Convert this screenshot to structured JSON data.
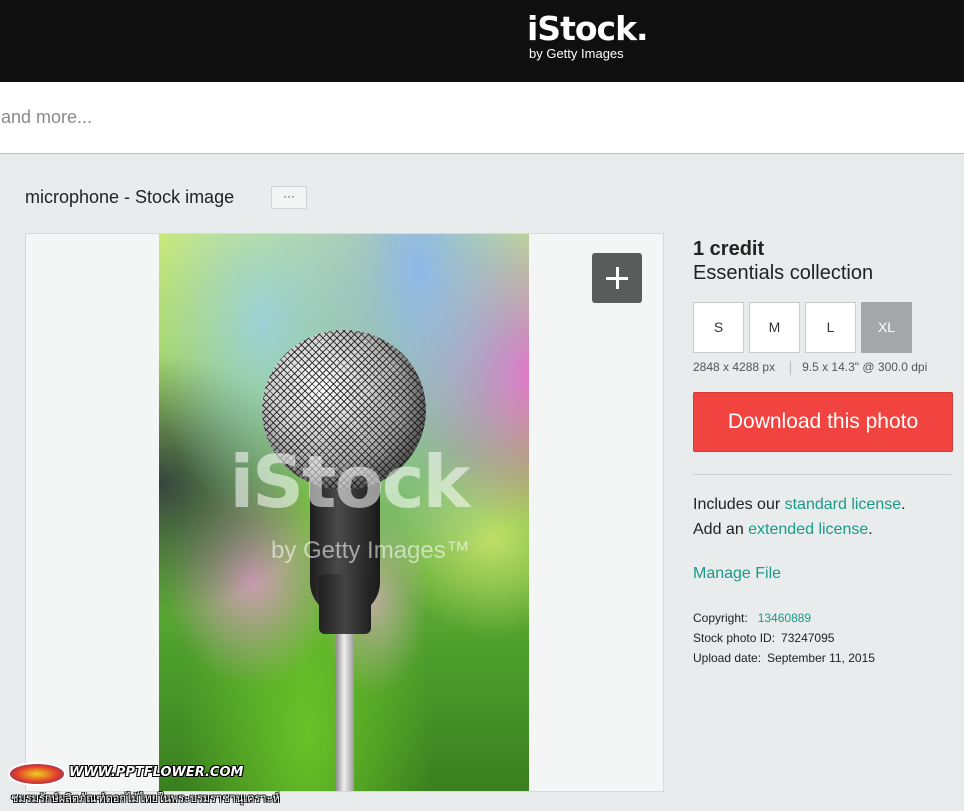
{
  "header": {
    "logo_main": "iStock.",
    "logo_sub": "by Getty Images"
  },
  "search": {
    "placeholder": "vectors and more..."
  },
  "page": {
    "title": "microphone - Stock image",
    "more_label": "···"
  },
  "preview": {
    "watermark_main": "iStock",
    "watermark_sub": "by Getty Images™"
  },
  "purchase": {
    "credit": "1 credit",
    "collection": "Essentials collection",
    "sizes": [
      {
        "label": "S",
        "selected": false
      },
      {
        "label": "M",
        "selected": false
      },
      {
        "label": "L",
        "selected": false
      },
      {
        "label": "XL",
        "selected": true
      }
    ],
    "pixel_dimensions": "2848 x 4288 px",
    "print_dimensions": "9.5 x 14.3\" @ 300.0 dpi",
    "download_label": "Download this photo"
  },
  "license": {
    "line1_prefix": "Includes our ",
    "line1_link": "standard license",
    "line1_suffix": ".",
    "line2_prefix": "Add an ",
    "line2_link": "extended license",
    "line2_suffix": "."
  },
  "manage_file": "Manage File",
  "meta": {
    "copyright_label": "Copyright:",
    "copyright_value": "13460889",
    "stock_id_label": "Stock photo ID:",
    "stock_id_value": "73247095",
    "upload_label": "Upload date:",
    "upload_value": "September 11, 2015"
  },
  "footer": {
    "url": "WWW.PPTFLOWER.COM",
    "thai_text": "ชมรมรักษ์ผลิตภัณฑ์ดอกไม้ไทยในพระบรมราชานุเคราะห์"
  },
  "colors": {
    "accent": "#1a9a88",
    "download": "#f1433f",
    "header_bg": "#0f0f0f"
  }
}
